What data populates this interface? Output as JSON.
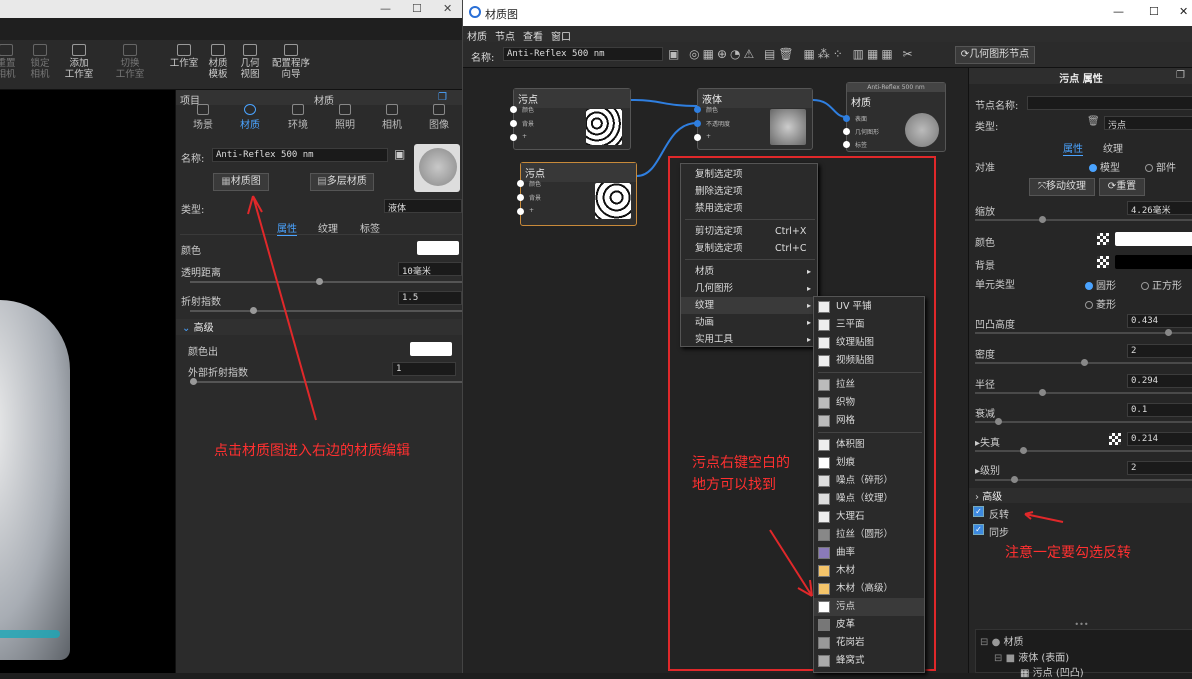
{
  "left_toolbar": {
    "buttons": [
      "重置\n相机",
      "锁定\n相机",
      "添加\n工作室",
      "切换\n工作室",
      "工作室",
      "材质\n模板",
      "几何\n视图",
      "配置程序\n向导"
    ]
  },
  "project_panel": {
    "header_left": "项目",
    "header_center": "材质",
    "tabs": [
      "场景",
      "材质",
      "环境",
      "照明",
      "相机",
      "图像"
    ],
    "name_label": "名称:",
    "name_value": "Anti-Reflex 500 nm",
    "material_graph_button": "材质图",
    "multilayer_button": "多层材质",
    "type_label": "类型:",
    "type_value": "液体",
    "subtabs": [
      "属性",
      "纹理",
      "标签"
    ],
    "color_label": "颜色",
    "transparency_label": "透明距离",
    "transparency_value": "10毫米",
    "ior_label": "折射指数",
    "ior_value": "1.5",
    "advanced_label": "高级",
    "color_out_label": "颜色出",
    "outer_ior_label": "外部折射指数",
    "outer_ior_value": "1"
  },
  "annotations": {
    "left": "点击材质图进入右边的材质编辑",
    "middle": "污点右键空白的\n地方可以找到",
    "right": "注意一定要勾选反转"
  },
  "mg_window": {
    "title": "材质图",
    "menu": [
      "材质",
      "节点",
      "查看",
      "窗口"
    ],
    "name_label": "名称:",
    "name_value": "Anti-Reflex 500 nm",
    "geometry_node_button": "几何图形节点"
  },
  "nodes": {
    "spot1": {
      "title": "污点",
      "pins": [
        "颜色",
        "背景",
        "+"
      ]
    },
    "liquid": {
      "title": "液体",
      "pins": [
        "颜色",
        "不透明度",
        "+"
      ]
    },
    "spot2": {
      "title": "污点",
      "pins": [
        "颜色",
        "背景",
        "+"
      ]
    },
    "output": {
      "header": "Anti-Reflex 500 nm",
      "title": "材质",
      "pins": [
        "表面",
        "几何图形",
        "标签"
      ]
    }
  },
  "context_menu": {
    "items": [
      {
        "label": "复制选定项"
      },
      {
        "label": "删除选定项"
      },
      {
        "label": "禁用选定项"
      },
      {
        "label": "剪切选定项",
        "shortcut": "Ctrl+X"
      },
      {
        "label": "复制选定项",
        "shortcut": "Ctrl+C"
      },
      {
        "label": "材质",
        "arrow": "▸"
      },
      {
        "label": "几何图形",
        "arrow": "▸"
      },
      {
        "label": "纹理",
        "arrow": "▸"
      },
      {
        "label": "动画",
        "arrow": "▸"
      },
      {
        "label": "实用工具",
        "arrow": "▸"
      }
    ]
  },
  "texture_submenu": [
    "UV 平铺",
    "三平面",
    "纹理贴图",
    "视频贴图",
    "拉丝",
    "织物",
    "网格",
    "体积图",
    "划痕",
    "噪点（碎形）",
    "噪点（纹理）",
    "大理石",
    "拉丝（圆形）",
    "曲率",
    "木材",
    "木材（高级）",
    "污点",
    "皮革",
    "花岗岩",
    "蜂窝式"
  ],
  "attributes": {
    "header": "污点 属性",
    "node_name_label": "节点名称:",
    "type_label": "类型:",
    "type_value": "污点",
    "tabs": [
      "属性",
      "纹理"
    ],
    "align_label": "对准",
    "align_options": [
      "模型",
      "部件"
    ],
    "move_texture_button": "移动纹理",
    "reset_button": "重置",
    "scale_label": "缩放",
    "scale_value": "4.26毫米",
    "color_label": "颜色",
    "background_label": "背景",
    "cell_type_label": "单元类型",
    "cell_types": [
      "圆形",
      "正方形",
      "菱形"
    ],
    "bump_label": "凹凸高度",
    "bump_value": "0.434",
    "density_label": "密度",
    "density_value": "2",
    "radius_label": "半径",
    "radius_value": "0.294",
    "falloff_label": "衰减",
    "falloff_value": "0.1",
    "distortion_label": "失真",
    "distortion_value": "0.214",
    "level_label": "级别",
    "level_value": "2",
    "advanced_label": "高级",
    "invert_label": "反转",
    "sync_label": "同步",
    "tree": [
      "材质",
      "液体 (表面)",
      "污点 (凹凸)"
    ]
  }
}
